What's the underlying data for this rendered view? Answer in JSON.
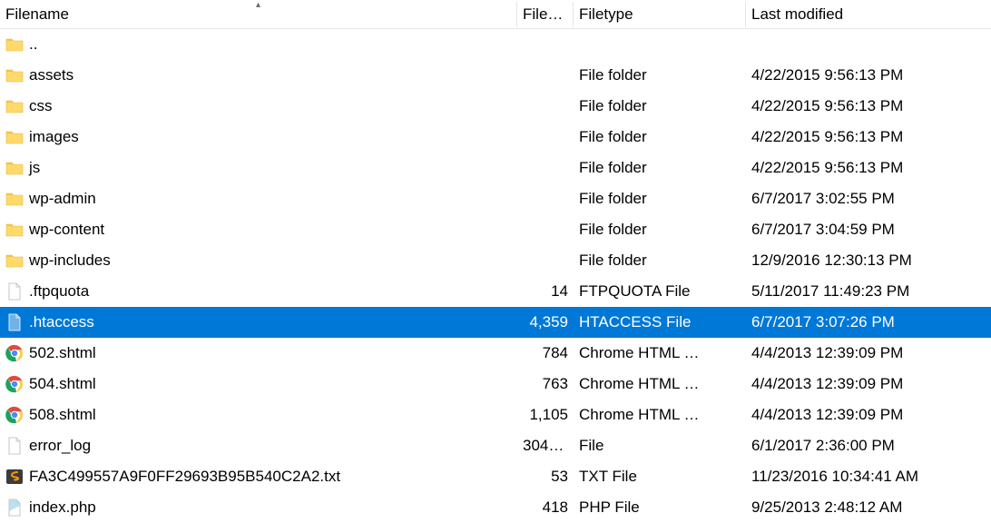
{
  "columns": {
    "filename": "Filename",
    "filesize": "File…",
    "filetype": "Filetype",
    "lastmodified": "Last modified"
  },
  "sort": {
    "column": "filename",
    "direction": "asc",
    "glyph": "▴"
  },
  "rows": [
    {
      "icon": "folder",
      "name": "..",
      "size": "",
      "type": "",
      "date": "",
      "selected": false
    },
    {
      "icon": "folder",
      "name": "assets",
      "size": "",
      "type": "File folder",
      "date": "4/22/2015 9:56:13 PM",
      "selected": false
    },
    {
      "icon": "folder",
      "name": "css",
      "size": "",
      "type": "File folder",
      "date": "4/22/2015 9:56:13 PM",
      "selected": false
    },
    {
      "icon": "folder",
      "name": "images",
      "size": "",
      "type": "File folder",
      "date": "4/22/2015 9:56:13 PM",
      "selected": false
    },
    {
      "icon": "folder",
      "name": "js",
      "size": "",
      "type": "File folder",
      "date": "4/22/2015 9:56:13 PM",
      "selected": false
    },
    {
      "icon": "folder",
      "name": "wp-admin",
      "size": "",
      "type": "File folder",
      "date": "6/7/2017 3:02:55 PM",
      "selected": false
    },
    {
      "icon": "folder",
      "name": "wp-content",
      "size": "",
      "type": "File folder",
      "date": "6/7/2017 3:04:59 PM",
      "selected": false
    },
    {
      "icon": "folder",
      "name": "wp-includes",
      "size": "",
      "type": "File folder",
      "date": "12/9/2016 12:30:13 PM",
      "selected": false
    },
    {
      "icon": "file",
      "name": ".ftpquota",
      "size": "14",
      "type": "FTPQUOTA File",
      "date": "5/11/2017 11:49:23 PM",
      "selected": false
    },
    {
      "icon": "file-sel",
      "name": ".htaccess",
      "size": "4,359",
      "type": "HTACCESS File",
      "date": "6/7/2017 3:07:26 PM",
      "selected": true
    },
    {
      "icon": "chrome",
      "name": "502.shtml",
      "size": "784",
      "type": "Chrome HTML …",
      "date": "4/4/2013 12:39:09 PM",
      "selected": false
    },
    {
      "icon": "chrome",
      "name": "504.shtml",
      "size": "763",
      "type": "Chrome HTML …",
      "date": "4/4/2013 12:39:09 PM",
      "selected": false
    },
    {
      "icon": "chrome",
      "name": "508.shtml",
      "size": "1,105",
      "type": "Chrome HTML …",
      "date": "4/4/2013 12:39:09 PM",
      "selected": false
    },
    {
      "icon": "file",
      "name": "error_log",
      "size": "304,…",
      "type": "File",
      "date": "6/1/2017 2:36:00 PM",
      "selected": false
    },
    {
      "icon": "sublime",
      "name": "FA3C499557A9F0FF29693B95B540C2A2.txt",
      "size": "53",
      "type": "TXT File",
      "date": "11/23/2016 10:34:41 AM",
      "selected": false
    },
    {
      "icon": "php",
      "name": "index.php",
      "size": "418",
      "type": "PHP File",
      "date": "9/25/2013 2:48:12 AM",
      "selected": false
    }
  ]
}
